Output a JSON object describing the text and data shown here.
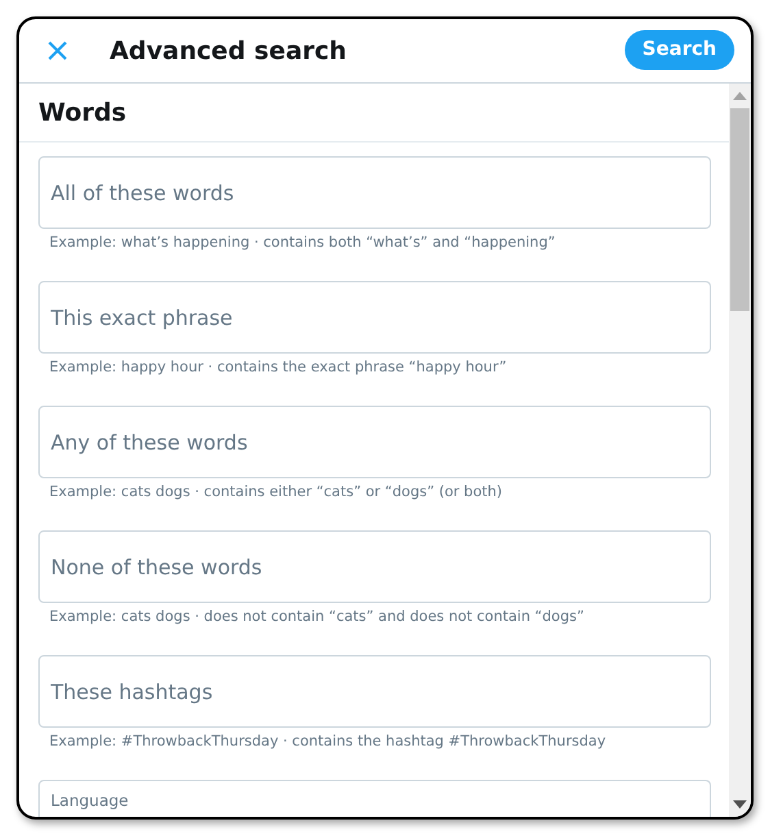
{
  "header": {
    "title": "Advanced search",
    "search_button": "Search"
  },
  "section": {
    "title": "Words"
  },
  "fields": [
    {
      "placeholder": "All of these words",
      "hint": "Example: what’s happening · contains both “what’s” and “happening”"
    },
    {
      "placeholder": "This exact phrase",
      "hint": "Example: happy hour · contains the exact phrase “happy hour”"
    },
    {
      "placeholder": "Any of these words",
      "hint": "Example: cats dogs · contains either “cats” or “dogs” (or both)"
    },
    {
      "placeholder": "None of these words",
      "hint": "Example: cats dogs · does not contain “cats” and does not contain “dogs”"
    },
    {
      "placeholder": "These hashtags",
      "hint": "Example: #ThrowbackThursday · contains the hashtag #ThrowbackThursday"
    }
  ],
  "language": {
    "label": "Language"
  }
}
